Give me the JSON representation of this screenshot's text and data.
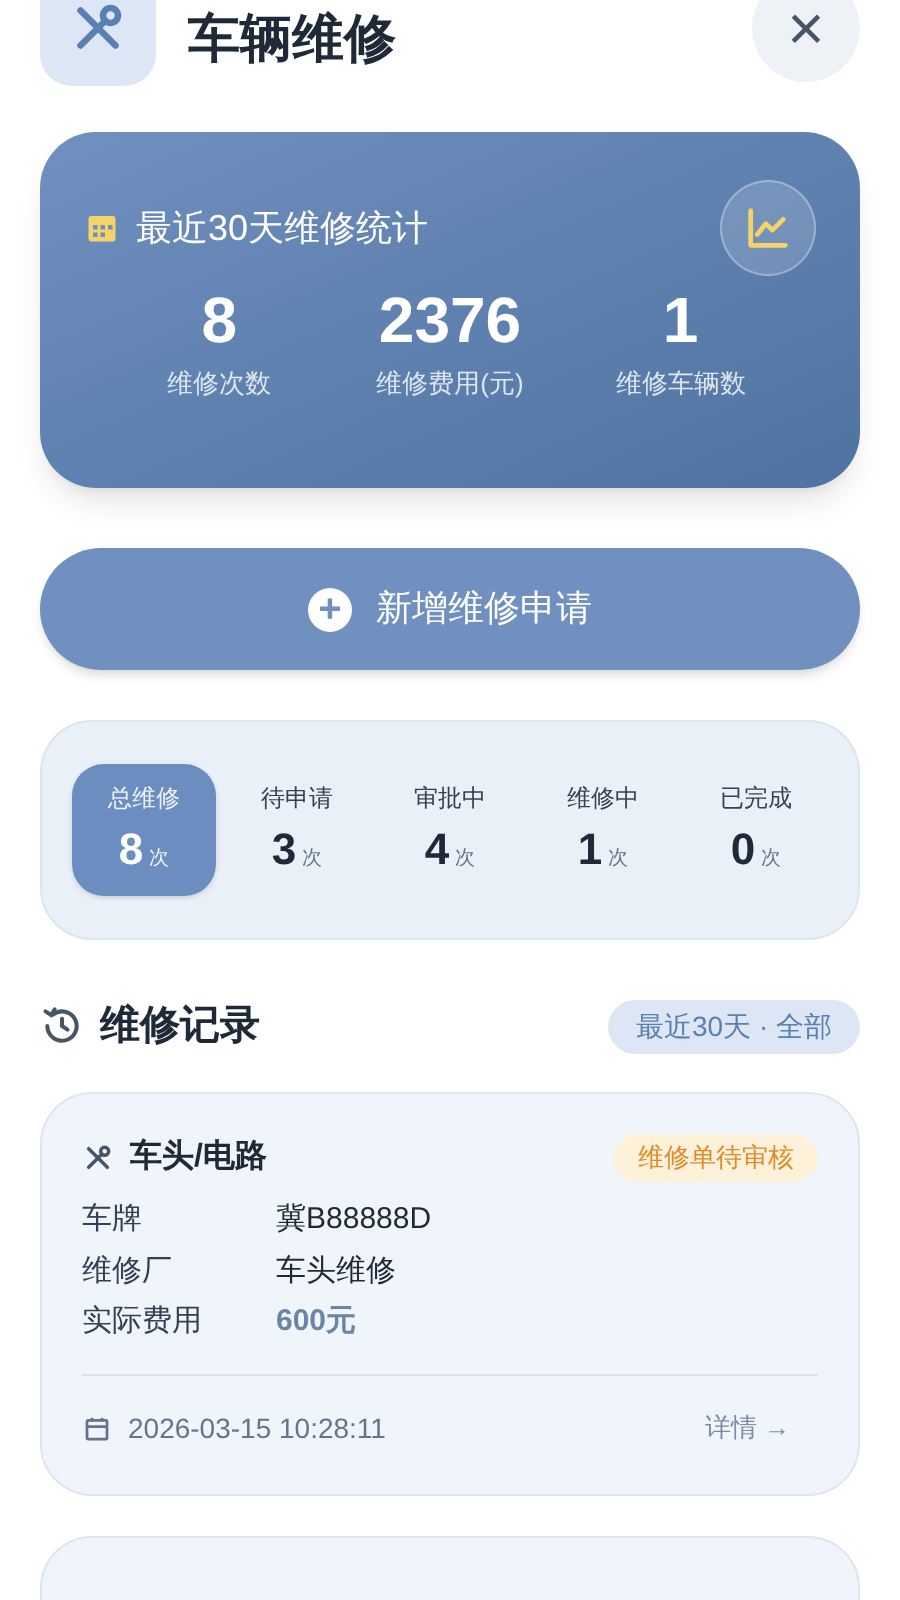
{
  "header": {
    "title": "车辆维修",
    "close": "×"
  },
  "stats": {
    "title": "最近30天维修统计",
    "items": [
      {
        "value": "8",
        "label": "维修次数"
      },
      {
        "value": "2376",
        "label": "维修费用(元)"
      },
      {
        "value": "1",
        "label": "维修车辆数"
      }
    ]
  },
  "add_button": {
    "icon": "+",
    "label": "新增维修申请"
  },
  "status_tabs": [
    {
      "label": "总维修",
      "count": "8",
      "unit": "次",
      "selected": true
    },
    {
      "label": "待申请",
      "count": "3",
      "unit": "次",
      "selected": false
    },
    {
      "label": "审批中",
      "count": "4",
      "unit": "次",
      "selected": false
    },
    {
      "label": "维修中",
      "count": "1",
      "unit": "次",
      "selected": false
    },
    {
      "label": "已完成",
      "count": "0",
      "unit": "次",
      "selected": false
    }
  ],
  "records_section": {
    "title": "维修记录",
    "filter": "最近30天 · 全部"
  },
  "records": [
    {
      "title": "车头/电路",
      "status": "维修单待审核",
      "fields": [
        {
          "label": "车牌",
          "value": "冀B88888D",
          "kind": "plain"
        },
        {
          "label": "维修厂",
          "value": "车头维修",
          "kind": "plain"
        },
        {
          "label": "实际费用",
          "value": "600元",
          "kind": "cost"
        }
      ],
      "time": "2026-03-15 10:28:11",
      "detail": "详情 →"
    }
  ]
}
